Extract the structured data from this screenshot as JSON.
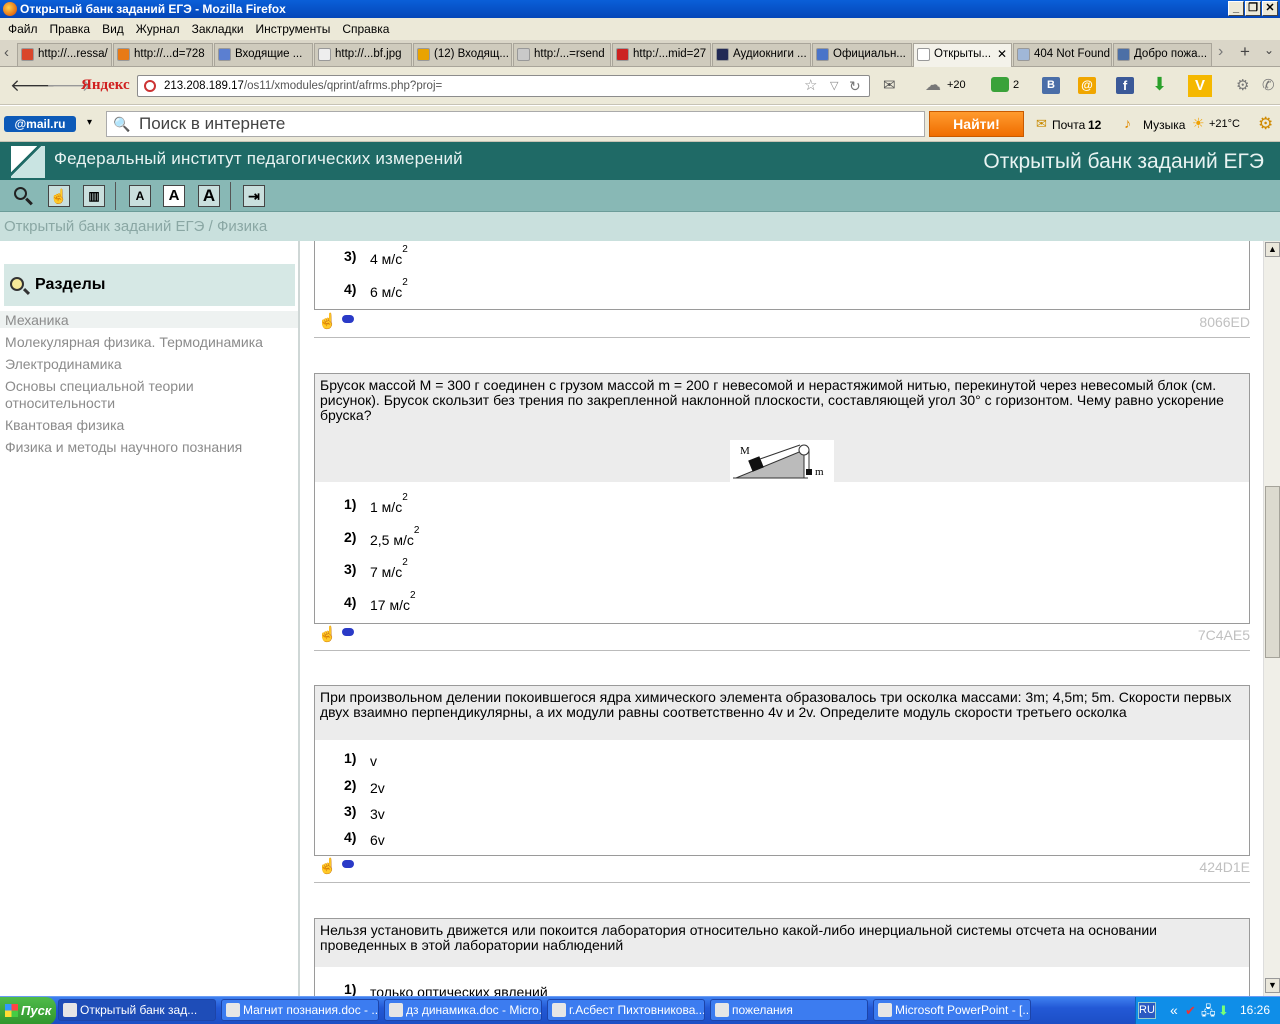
{
  "window": {
    "title": "Открытый банк заданий ЕГЭ - Mozilla Firefox"
  },
  "menu": [
    "Файл",
    "Правка",
    "Вид",
    "Журнал",
    "Закладки",
    "Инструменты",
    "Справка"
  ],
  "tabs": [
    {
      "label": "http://...ressa/",
      "color": "#d9462b"
    },
    {
      "label": "http://...d=728",
      "color": "#e87a16"
    },
    {
      "label": "Входящие ...",
      "color": "#5b7fd1"
    },
    {
      "label": "http://...bf.jpg",
      "color": "#eeeeee"
    },
    {
      "label": "(12) Входящ...",
      "color": "#e9a300"
    },
    {
      "label": "http:/...=rsend",
      "color": "#c9c9c9"
    },
    {
      "label": "http:/...mid=27",
      "color": "#cc2222"
    },
    {
      "label": "Аудиокниги ...",
      "color": "#222a55"
    },
    {
      "label": "Официальн...",
      "color": "#4a74c9"
    },
    {
      "label": "Открыты...",
      "color": "#ffffff",
      "active": true
    },
    {
      "label": "404 Not Found",
      "color": "#a0b7d8"
    },
    {
      "label": "Добро пожа...",
      "color": "#4c6fa6"
    }
  ],
  "nav": {
    "yandex": "Яндекс",
    "url_host": "213.208.189.17",
    "url_path": "/os11/xmodules/qprint/afrms.php?proj=",
    "weather_count": "+20",
    "notif_count": "2"
  },
  "mailbar": {
    "logo": "@mail.ru",
    "search_placeholder": "Поиск в интернете",
    "find_button": "Найти!",
    "mail_label": "Почта",
    "mail_count": "12",
    "music_label": "Музыка",
    "temperature": "+21°C"
  },
  "site": {
    "org": "Федеральный институт педагогических измерений",
    "bank": "Открытый банк заданий ЕГЭ",
    "breadcrumb": "Открытый банк заданий ЕГЭ / Физика"
  },
  "sidebar": {
    "heading": "Разделы",
    "items": [
      "Механика",
      "Молекулярная физика. Термодинамика",
      "Электродинамика",
      "Основы специальной теории относительности",
      "Квантовая физика",
      "Физика и методы научного познания"
    ]
  },
  "questions": [
    {
      "answers": [
        {
          "num": "3)",
          "value": "4 м/с",
          "sup": "2"
        },
        {
          "num": "4)",
          "value": "6 м/с",
          "sup": "2"
        }
      ],
      "code": "8066ED"
    },
    {
      "text": "Брусок массой  M = 300 г соединен с грузом массой m = 200 г невесомой и нерастяжимой нитью, перекинутой через невесомый блок (см. рисунок). Брусок  скользит без трения по закрепленной наклонной плоскости,  составляющей угол 30° с горизонтом. Чему равно ускорение бруска?",
      "figure_M": "M",
      "figure_m": "m",
      "answers": [
        {
          "num": "1)",
          "value": "1 м/с",
          "sup": "2"
        },
        {
          "num": "2)",
          "value": "2,5 м/с",
          "sup": "2"
        },
        {
          "num": "3)",
          "value": "7 м/с",
          "sup": "2"
        },
        {
          "num": "4)",
          "value": "17 м/с",
          "sup": "2"
        }
      ],
      "code": "7C4AE5"
    },
    {
      "text": "При произвольном делении покоившегося ядра химического элемента образовалось три осколка массами: 3m; 4,5m; 5m. Скорости первых двух взаимно перпендикулярны, а их модули равны соответственно 4v и 2v. Определите модуль скорости третьего осколка",
      "answers": [
        {
          "num": "1)",
          "value": "v"
        },
        {
          "num": "2)",
          "value": "2v"
        },
        {
          "num": "3)",
          "value": "3v"
        },
        {
          "num": "4)",
          "value": "6v"
        }
      ],
      "code": "424D1E"
    },
    {
      "text": "Нельзя установить движется или покоится лаборатория относительно какой-либо инерциальной системы отсчета на основании проведенных в этой лаборатории наблюдений",
      "answers": [
        {
          "num": "1)",
          "value": "только оптических явлений"
        }
      ]
    }
  ],
  "taskbar": {
    "start": "Пуск",
    "tasks": [
      {
        "label": "Открытый банк зад...",
        "active": true
      },
      {
        "label": "Магнит познания.doc - ..."
      },
      {
        "label": "дз динамика.doc - Micro..."
      },
      {
        "label": "г.Асбест Пихтовникова..."
      },
      {
        "label": "пожелания"
      },
      {
        "label": "Microsoft PowerPoint - [..."
      }
    ],
    "lang": "RU",
    "clock": "16:26"
  }
}
